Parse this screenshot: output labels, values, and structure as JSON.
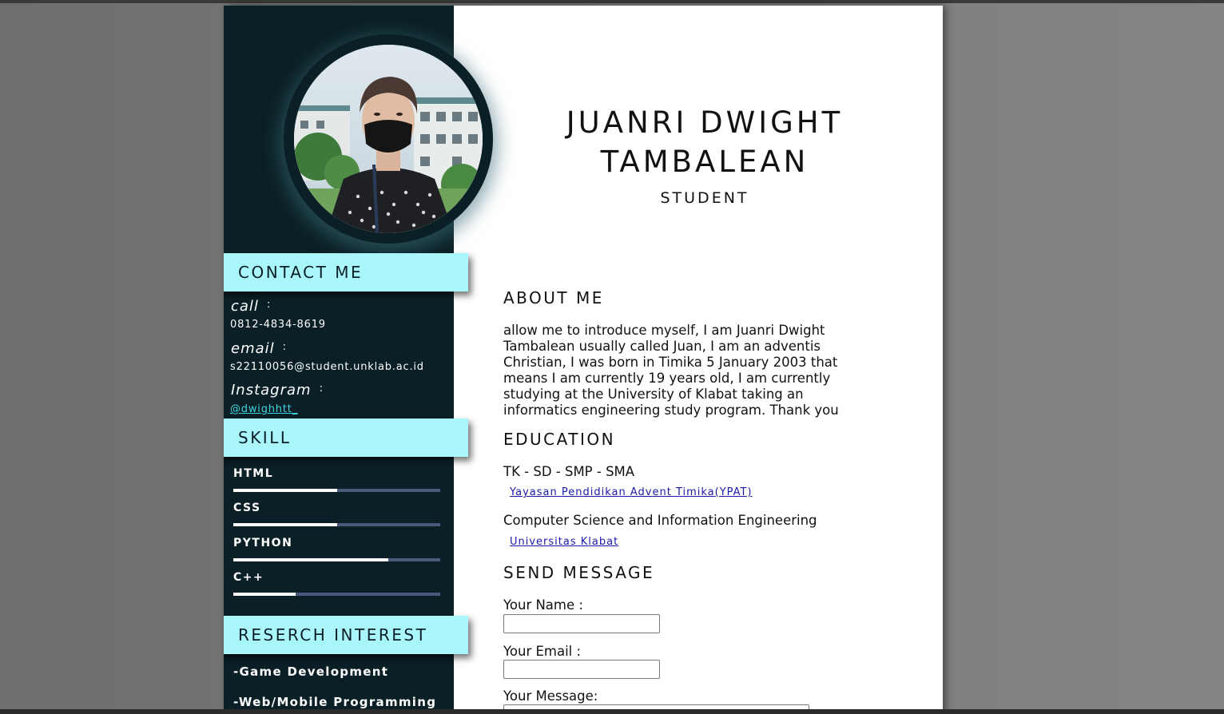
{
  "profile": {
    "name_line1": "JUANRI DWIGHT",
    "name_line2": "TAMBALEAN",
    "role": "STUDENT"
  },
  "sidebar": {
    "contact_heading": "CONTACT ME",
    "contacts": [
      {
        "label": "call",
        "value": "0812-4834-8619"
      },
      {
        "label": "email",
        "value": "s22110056@student.unklab.ac.id"
      },
      {
        "label": "Instagram",
        "value": "@dwighhtt_"
      }
    ],
    "colon": ":",
    "skill_heading": "SKILL",
    "skills": [
      {
        "name": "HTML",
        "level": 0.5
      },
      {
        "name": "CSS",
        "level": 0.5
      },
      {
        "name": "PYTHON",
        "level": 0.75
      },
      {
        "name": "C++",
        "level": 0.3
      }
    ],
    "interest_heading": "RESERCH INTEREST",
    "interests": [
      "-Game Development",
      "-Web/Mobile Programming"
    ]
  },
  "about": {
    "heading": "ABOUT ME",
    "text": "allow me to introduce myself, I am Juanri Dwight Tambalean usually called Juan, I am an adventis Christian, I was born in Timika 5 January 2003 that means I am currently 19 years old, I am currently studying at the University of Klabat taking an informatics engineering study program. Thank you"
  },
  "education": {
    "heading": "EDUCATION",
    "entries": [
      {
        "level": "TK - SD - SMP - SMA",
        "school": "Yayasan Pendidikan Advent Timika(YPAT)"
      },
      {
        "level": "Computer Science and Information Engineering",
        "school": "Universitas Klabat"
      }
    ]
  },
  "message": {
    "heading": "SEND MESSAGE",
    "name_label": "Your Name :",
    "email_label": "Your Email :",
    "message_label": "Your Message:"
  },
  "colors": {
    "sidebar_bg": "#0a2026",
    "tab_bg": "#aaf7fb",
    "skill_track": "#4b5a7c",
    "link": "#1a1aa6",
    "instagram_link": "#3fd4df"
  }
}
